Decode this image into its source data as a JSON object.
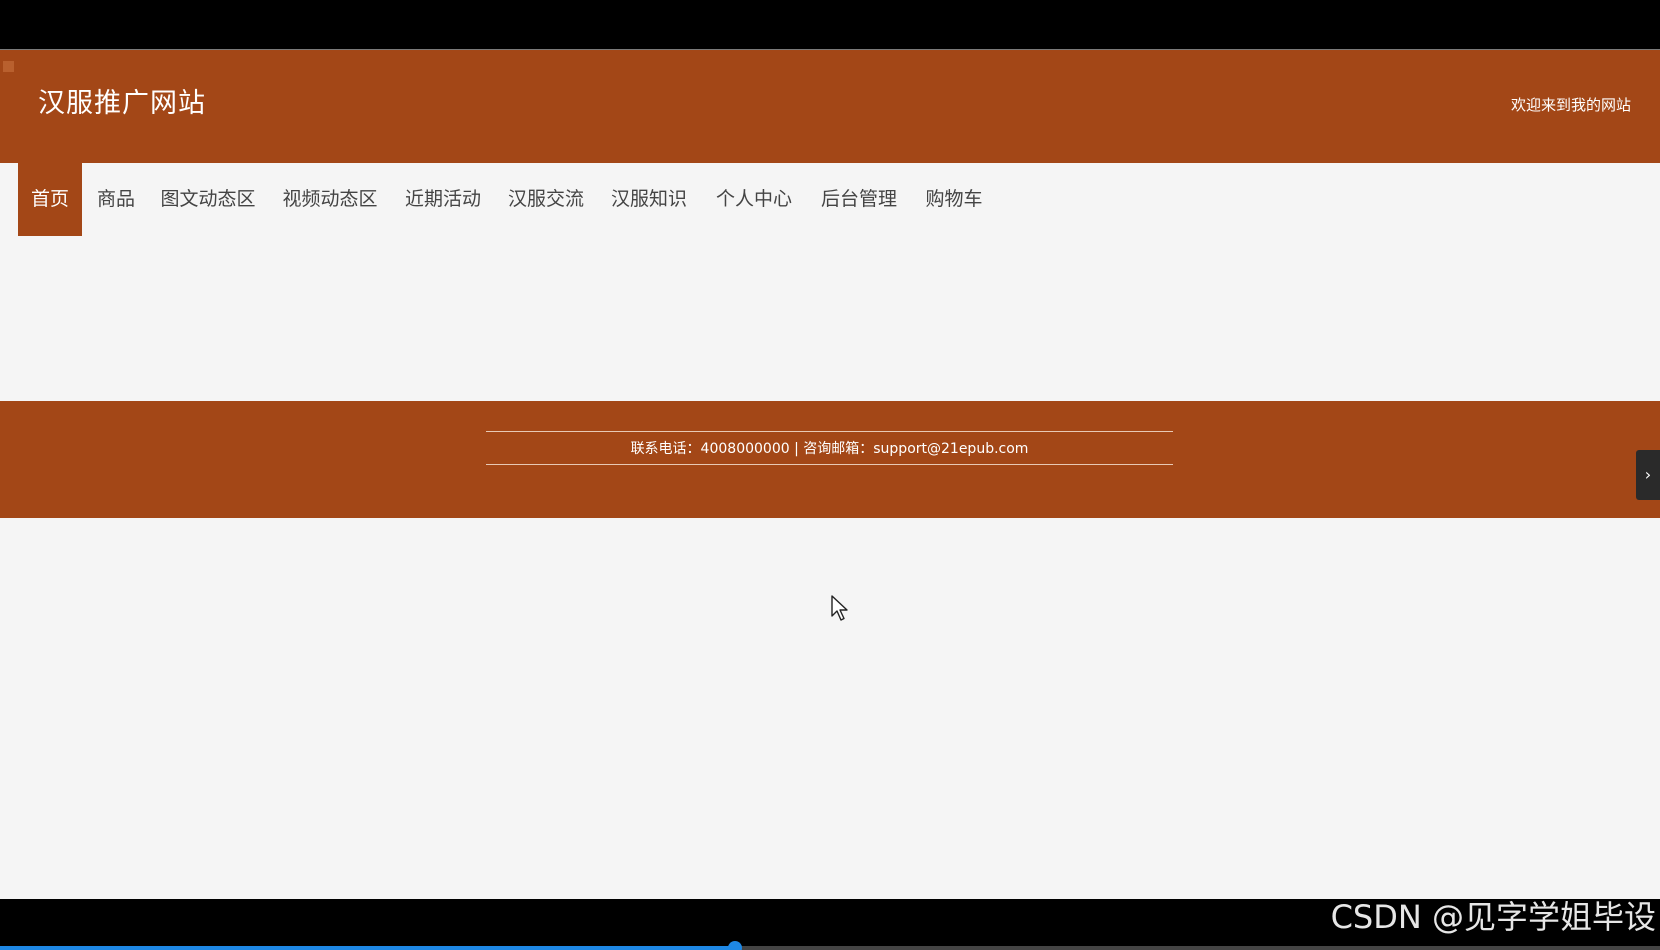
{
  "header": {
    "title": "汉服推广网站",
    "welcome": "欢迎来到我的网站"
  },
  "nav": {
    "items": [
      {
        "label": "首页",
        "active": true
      },
      {
        "label": "商品"
      },
      {
        "label": "图文动态区"
      },
      {
        "label": "视频动态区"
      },
      {
        "label": "近期活动"
      },
      {
        "label": "汉服交流"
      },
      {
        "label": "汉服知识"
      },
      {
        "label": "个人中心"
      },
      {
        "label": "后台管理"
      },
      {
        "label": "购物车"
      }
    ]
  },
  "footer": {
    "contact": "联系电话：4008000000 | 咨询邮箱：support@21epub.com"
  },
  "side_toggle": {
    "icon": "chevron-right-icon",
    "glyph": "›"
  },
  "watermark": "CSDN @见字学姐毕设",
  "video": {
    "progress": 0.443
  },
  "colors": {
    "brand": "#a34717",
    "page_bg": "#f5f5f5",
    "nav_text": "#444444"
  }
}
